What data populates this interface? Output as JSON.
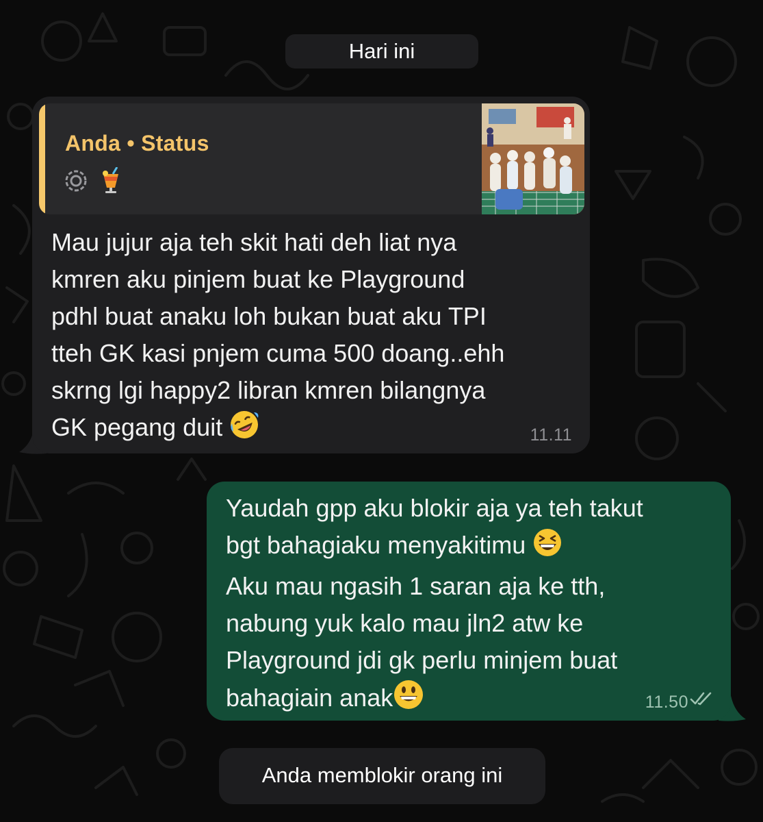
{
  "conversation": {
    "date_divider": "Hari ini",
    "system_notice": "Anda memblokir orang ini"
  },
  "incoming": {
    "quote": {
      "author": "Anda • Status",
      "icons": [
        "status-ring-icon",
        "tropical-drink-emoji"
      ],
      "accent_color": "#f6c86b"
    },
    "text_lines": [
      "Mau jujur aja teh skit hati deh liat nya",
      "kmren aku pinjem buat ke Playground",
      "pdhl buat anaku loh bukan buat aku TPI",
      "tteh GK kasi pnjem cuma 500 doang..ehh",
      "skrng lgi happy2 libran kmren bilangnya",
      "GK pegang duit"
    ],
    "trailing_emoji": "rolling-on-floor-laughing-emoji",
    "time": "11.11",
    "bubble_color": "#1f1f21"
  },
  "outgoing": {
    "text_lines": [
      "Yaudah gpp aku blokir aja ya teh takut",
      "bgt bahagiaku menyakitimu",
      "Aku mau ngasih 1 saran aja ke tth,",
      "nabung yuk kalo mau jln2 atw ke",
      "Playground jdi gk perlu minjem buat",
      "bahagiain anak"
    ],
    "line2_emoji": "grinning-squinting-face-emoji",
    "line6_emoji": "grinning-face-emoji",
    "time": "11.50",
    "status_icon": "double-check-icon",
    "bubble_color": "#134d37"
  }
}
